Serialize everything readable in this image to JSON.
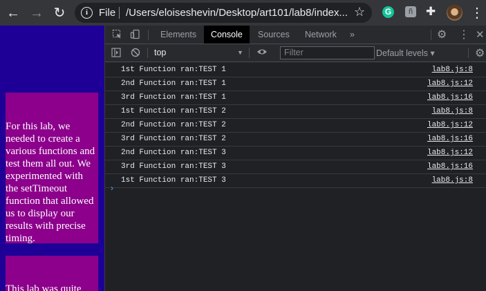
{
  "browser": {
    "back_icon": "←",
    "forward_icon": "→",
    "reload_icon": "↻",
    "info_icon": "i",
    "scheme": "File",
    "url": "/Users/eloiseshevin/Desktop/art101/lab8/index...",
    "star_icon": "☆",
    "ext_g": "G",
    "ext_sq": "ñ",
    "menu_icon": "⋮"
  },
  "page": {
    "block1_text": "For this lab, we needed to create a various functions and test them all out. We experimented with the setTimeout function that allowed us to display our results with precise timing.",
    "block2_text": "This lab was quite"
  },
  "devtools": {
    "tabs": [
      "Elements",
      "Console",
      "Sources",
      "Network"
    ],
    "active_tab": "Console",
    "more_tabs": "»",
    "context": "top",
    "filter_placeholder": "Filter",
    "levels": "Default levels ▾",
    "log": [
      {
        "msg": "1st Function ran:TEST 1",
        "src": "lab8.js:8"
      },
      {
        "msg": "2nd Function ran:TEST 1",
        "src": "lab8.js:12"
      },
      {
        "msg": "3rd Function ran:TEST 1",
        "src": "lab8.js:16"
      },
      {
        "msg": "1st Function ran:TEST 2",
        "src": "lab8.js:8"
      },
      {
        "msg": "2nd Function ran:TEST 2",
        "src": "lab8.js:12"
      },
      {
        "msg": "3rd Function ran:TEST 2",
        "src": "lab8.js:16"
      },
      {
        "msg": "2nd Function ran:TEST 3",
        "src": "lab8.js:12"
      },
      {
        "msg": "3rd Function ran:TEST 3",
        "src": "lab8.js:16"
      },
      {
        "msg": "1st Function ran:TEST 3",
        "src": "lab8.js:8"
      }
    ],
    "prompt": "›"
  },
  "colors": {
    "page_bg": "#1e0096",
    "block_bg": "#8c008c",
    "devtools_bg": "#202124"
  }
}
